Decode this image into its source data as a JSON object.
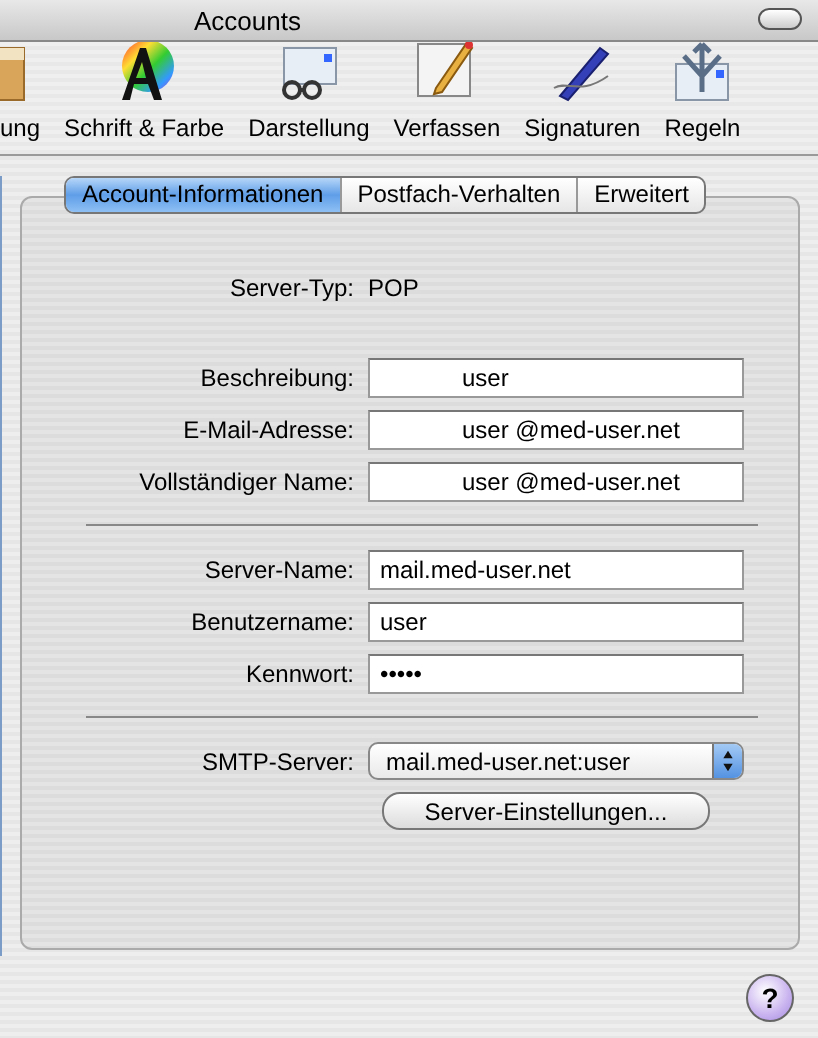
{
  "window": {
    "title": "Accounts"
  },
  "toolbar": [
    {
      "label": "ung"
    },
    {
      "label": "Schrift & Farbe"
    },
    {
      "label": "Darstellung"
    },
    {
      "label": "Verfassen"
    },
    {
      "label": "Signaturen"
    },
    {
      "label": "Regeln"
    }
  ],
  "tabs": [
    {
      "label": "Account-Informationen",
      "selected": true
    },
    {
      "label": "Postfach-Verhalten",
      "selected": false
    },
    {
      "label": "Erweitert",
      "selected": false
    }
  ],
  "groups": [
    {
      "rows": [
        {
          "kind": "static",
          "label": "Server-Typ:",
          "value": "POP"
        }
      ]
    },
    {
      "divider": false,
      "rows": [
        {
          "kind": "text",
          "label": "Beschreibung:",
          "value": "user",
          "indented": true
        },
        {
          "kind": "text",
          "label": "E-Mail-Adresse:",
          "value": "user @med-user.net",
          "indented": true
        },
        {
          "kind": "text",
          "label": "Vollständiger Name:",
          "value": "user @med-user.net",
          "indented": true
        }
      ]
    },
    {
      "divider": true,
      "rows": [
        {
          "kind": "text",
          "label": "Server-Name:",
          "value": "mail.med-user.net",
          "indented": false
        },
        {
          "kind": "text",
          "label": "Benutzername:",
          "value": "user",
          "indented": false
        },
        {
          "kind": "text",
          "label": "Kennwort:",
          "value": "•••••",
          "indented": false
        }
      ]
    },
    {
      "divider": true,
      "rows": [
        {
          "kind": "select",
          "label": "SMTP-Server:",
          "value": "mail.med-user.net:user"
        },
        {
          "kind": "button",
          "label": "Server-Einstellungen..."
        }
      ]
    }
  ],
  "help": "?"
}
